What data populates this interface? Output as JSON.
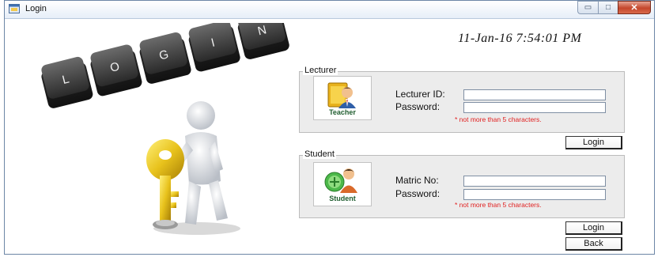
{
  "window": {
    "title": "Login",
    "minimize_glyph": "▭",
    "maximize_glyph": "□",
    "close_glyph": "✕"
  },
  "datetime": "11-Jan-16 7:54:01 PM",
  "keys": [
    "L",
    "O",
    "G",
    "I",
    "N"
  ],
  "lecturer": {
    "legend": "Lecturer",
    "avatar_caption": "Teacher",
    "id_label": "Lecturer ID:",
    "id_value": "",
    "password_label": "Password:",
    "password_value": "",
    "hint": "* not more than 5 characters.",
    "login_button": "Login"
  },
  "student": {
    "legend": "Student",
    "avatar_caption": "Student",
    "matric_label": "Matric No:",
    "matric_value": "",
    "password_label": "Password:",
    "password_value": "",
    "hint": "* not more than 5 characters.",
    "login_button": "Login"
  },
  "back_button": "Back",
  "colors": {
    "hint": "#e02020",
    "group_bg": "#ececec",
    "caption_green": "#1f5d2f",
    "key_gold": "#e8c21c"
  },
  "icons": [
    "app-window-icon",
    "teacher-icon",
    "student-icon",
    "key-figure-illustration",
    "keyboard-keys-illustration"
  ]
}
